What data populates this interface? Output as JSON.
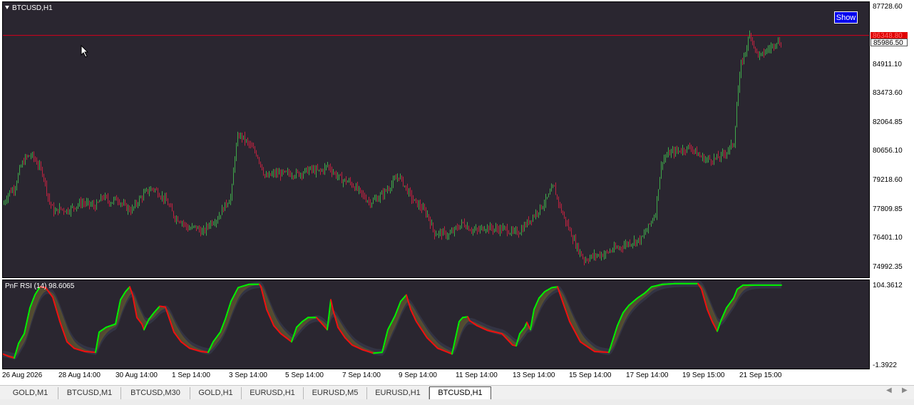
{
  "window": {
    "symbol_title": "BTCUSD,H1"
  },
  "price_panel": {
    "show_button": "Show",
    "y_ticks": [
      "87728.60",
      "84911.10",
      "83473.60",
      "82064.85",
      "80656.10",
      "79218.60",
      "77809.85",
      "76401.10",
      "74992.35"
    ],
    "current_price_red": "86348.80",
    "current_price_white": "85986.50",
    "colors": {
      "background": "#2a2630",
      "bull": "#3fa84a",
      "bear": "#c02340",
      "price_line": "#d9001b"
    }
  },
  "rsi_panel": {
    "title": "PnF RSI (14) 98.6065",
    "y_top": "104.3612",
    "y_bottom": "-1.3922",
    "colors": {
      "up_line": "#00ee00",
      "down_line": "#ee1111",
      "fill": "#5a5230",
      "shadow": "#3a3f55"
    }
  },
  "x_axis": {
    "labels": [
      "26 Aug 2026",
      "28 Aug 14:00",
      "30 Aug 14:00",
      "1 Sep 14:00",
      "3 Sep 14:00",
      "5 Sep 14:00",
      "7 Sep 14:00",
      "9 Sep 14:00",
      "11 Sep 14:00",
      "13 Sep 14:00",
      "15 Sep 14:00",
      "17 Sep 14:00",
      "19 Sep 15:00",
      "21 Sep 15:00"
    ]
  },
  "tabs": [
    {
      "label": "GOLD,M1"
    },
    {
      "label": "BTCUSD,M1"
    },
    {
      "label": "BTCUSD,M30"
    },
    {
      "label": "GOLD,H1"
    },
    {
      "label": "EURUSD,H1"
    },
    {
      "label": "EURUSD,M5"
    },
    {
      "label": "EURUSD,H1"
    },
    {
      "label": "BTCUSD,H1",
      "active": true
    }
  ],
  "chart_data": {
    "type": "candlestick",
    "symbol": "BTCUSD",
    "timeframe": "H1",
    "price_anchors": [
      [
        0,
        78100
      ],
      [
        8,
        78700
      ],
      [
        16,
        78900
      ],
      [
        24,
        79900
      ],
      [
        32,
        80400
      ],
      [
        40,
        80500
      ],
      [
        48,
        80100
      ],
      [
        56,
        79600
      ],
      [
        64,
        78300
      ],
      [
        72,
        77700
      ],
      [
        80,
        77900
      ],
      [
        90,
        77800
      ],
      [
        100,
        78000
      ],
      [
        110,
        78200
      ],
      [
        120,
        78100
      ],
      [
        130,
        78000
      ],
      [
        140,
        78500
      ],
      [
        150,
        78200
      ],
      [
        160,
        78400
      ],
      [
        170,
        78000
      ],
      [
        180,
        77800
      ],
      [
        190,
        78300
      ],
      [
        200,
        78700
      ],
      [
        210,
        78900
      ],
      [
        220,
        78600
      ],
      [
        230,
        78200
      ],
      [
        240,
        77500
      ],
      [
        250,
        77300
      ],
      [
        260,
        76900
      ],
      [
        270,
        77000
      ],
      [
        280,
        76700
      ],
      [
        290,
        77200
      ],
      [
        300,
        77400
      ],
      [
        310,
        78000
      ],
      [
        320,
        78500
      ],
      [
        325,
        80500
      ],
      [
        330,
        81500
      ],
      [
        335,
        81400
      ],
      [
        345,
        81000
      ],
      [
        355,
        80600
      ],
      [
        360,
        80200
      ],
      [
        368,
        79400
      ],
      [
        380,
        79600
      ],
      [
        400,
        79600
      ],
      [
        415,
        79600
      ],
      [
        430,
        79800
      ],
      [
        445,
        79700
      ],
      [
        455,
        80000
      ],
      [
        465,
        79600
      ],
      [
        475,
        79300
      ],
      [
        485,
        79200
      ],
      [
        495,
        78900
      ],
      [
        505,
        78500
      ],
      [
        515,
        78200
      ],
      [
        525,
        78400
      ],
      [
        535,
        78700
      ],
      [
        545,
        79100
      ],
      [
        555,
        79500
      ],
      [
        565,
        78900
      ],
      [
        575,
        78300
      ],
      [
        585,
        78000
      ],
      [
        595,
        77600
      ],
      [
        605,
        76700
      ],
      [
        615,
        76700
      ],
      [
        625,
        76600
      ],
      [
        635,
        76900
      ],
      [
        645,
        77200
      ],
      [
        655,
        76900
      ],
      [
        665,
        76800
      ],
      [
        675,
        77000
      ],
      [
        690,
        76900
      ],
      [
        705,
        76900
      ],
      [
        715,
        76700
      ],
      [
        725,
        76800
      ],
      [
        735,
        77200
      ],
      [
        745,
        77600
      ],
      [
        755,
        78000
      ],
      [
        765,
        78500
      ],
      [
        772,
        79000
      ],
      [
        778,
        78300
      ],
      [
        785,
        77600
      ],
      [
        795,
        76800
      ],
      [
        805,
        76000
      ],
      [
        815,
        75400
      ],
      [
        830,
        75600
      ],
      [
        845,
        75700
      ],
      [
        855,
        75900
      ],
      [
        865,
        76000
      ],
      [
        875,
        76200
      ],
      [
        885,
        76300
      ],
      [
        895,
        76400
      ],
      [
        905,
        77000
      ],
      [
        915,
        77700
      ],
      [
        920,
        79300
      ],
      [
        925,
        80300
      ],
      [
        935,
        80600
      ],
      [
        945,
        80700
      ],
      [
        955,
        80800
      ],
      [
        965,
        80900
      ],
      [
        975,
        80500
      ],
      [
        985,
        80300
      ],
      [
        995,
        80300
      ],
      [
        1005,
        80400
      ],
      [
        1015,
        80700
      ],
      [
        1025,
        81100
      ],
      [
        1030,
        83400
      ],
      [
        1035,
        84900
      ],
      [
        1042,
        85700
      ],
      [
        1048,
        86500
      ],
      [
        1055,
        85600
      ],
      [
        1062,
        85300
      ],
      [
        1070,
        85600
      ],
      [
        1078,
        85800
      ],
      [
        1085,
        86100
      ],
      [
        1092,
        85900
      ]
    ],
    "current_price": 85986.5,
    "rsi_period": 14,
    "rsi_last": 98.6065,
    "rsi_anchors": [
      [
        0,
        15
      ],
      [
        8,
        12
      ],
      [
        16,
        10
      ],
      [
        22,
        28
      ],
      [
        30,
        40
      ],
      [
        38,
        72
      ],
      [
        45,
        88
      ],
      [
        52,
        98
      ],
      [
        60,
        97
      ],
      [
        70,
        85
      ],
      [
        80,
        55
      ],
      [
        90,
        30
      ],
      [
        100,
        22
      ],
      [
        115,
        18
      ],
      [
        130,
        17
      ],
      [
        135,
        42
      ],
      [
        145,
        48
      ],
      [
        158,
        52
      ],
      [
        165,
        82
      ],
      [
        172,
        92
      ],
      [
        178,
        98
      ],
      [
        182,
        88
      ],
      [
        188,
        60
      ],
      [
        195,
        52
      ],
      [
        198,
        45
      ],
      [
        205,
        58
      ],
      [
        212,
        66
      ],
      [
        220,
        74
      ],
      [
        228,
        73
      ],
      [
        233,
        60
      ],
      [
        240,
        42
      ],
      [
        250,
        30
      ],
      [
        262,
        22
      ],
      [
        278,
        18
      ],
      [
        288,
        17
      ],
      [
        295,
        30
      ],
      [
        305,
        42
      ],
      [
        312,
        58
      ],
      [
        320,
        80
      ],
      [
        330,
        97
      ],
      [
        345,
        101
      ],
      [
        360,
        101
      ],
      [
        362,
        98
      ],
      [
        370,
        70
      ],
      [
        380,
        50
      ],
      [
        390,
        40
      ],
      [
        405,
        30
      ],
      [
        412,
        48
      ],
      [
        420,
        55
      ],
      [
        428,
        60
      ],
      [
        440,
        60
      ],
      [
        450,
        50
      ],
      [
        455,
        45
      ],
      [
        460,
        82
      ],
      [
        463,
        70
      ],
      [
        470,
        48
      ],
      [
        480,
        35
      ],
      [
        490,
        26
      ],
      [
        505,
        20
      ],
      [
        520,
        16
      ],
      [
        532,
        17
      ],
      [
        540,
        45
      ],
      [
        550,
        62
      ],
      [
        558,
        80
      ],
      [
        566,
        88
      ],
      [
        572,
        70
      ],
      [
        580,
        55
      ],
      [
        595,
        35
      ],
      [
        610,
        22
      ],
      [
        630,
        15
      ],
      [
        640,
        55
      ],
      [
        645,
        60
      ],
      [
        652,
        61
      ],
      [
        655,
        56
      ],
      [
        665,
        50
      ],
      [
        680,
        44
      ],
      [
        700,
        40
      ],
      [
        715,
        26
      ],
      [
        720,
        25
      ],
      [
        725,
        40
      ],
      [
        732,
        48
      ],
      [
        735,
        54
      ],
      [
        740,
        45
      ],
      [
        745,
        70
      ],
      [
        752,
        84
      ],
      [
        760,
        92
      ],
      [
        770,
        97
      ],
      [
        778,
        98
      ],
      [
        785,
        80
      ],
      [
        795,
        55
      ],
      [
        810,
        30
      ],
      [
        830,
        18
      ],
      [
        850,
        17
      ],
      [
        862,
        50
      ],
      [
        870,
        66
      ],
      [
        878,
        75
      ],
      [
        890,
        84
      ],
      [
        900,
        90
      ],
      [
        910,
        98
      ],
      [
        925,
        101
      ],
      [
        945,
        102
      ],
      [
        960,
        102
      ],
      [
        975,
        102
      ],
      [
        980,
        95
      ],
      [
        988,
        70
      ],
      [
        995,
        55
      ],
      [
        1002,
        43
      ],
      [
        1008,
        58
      ],
      [
        1015,
        72
      ],
      [
        1025,
        84
      ],
      [
        1030,
        95
      ],
      [
        1038,
        100
      ],
      [
        1060,
        100
      ],
      [
        1092,
        100
      ]
    ]
  }
}
